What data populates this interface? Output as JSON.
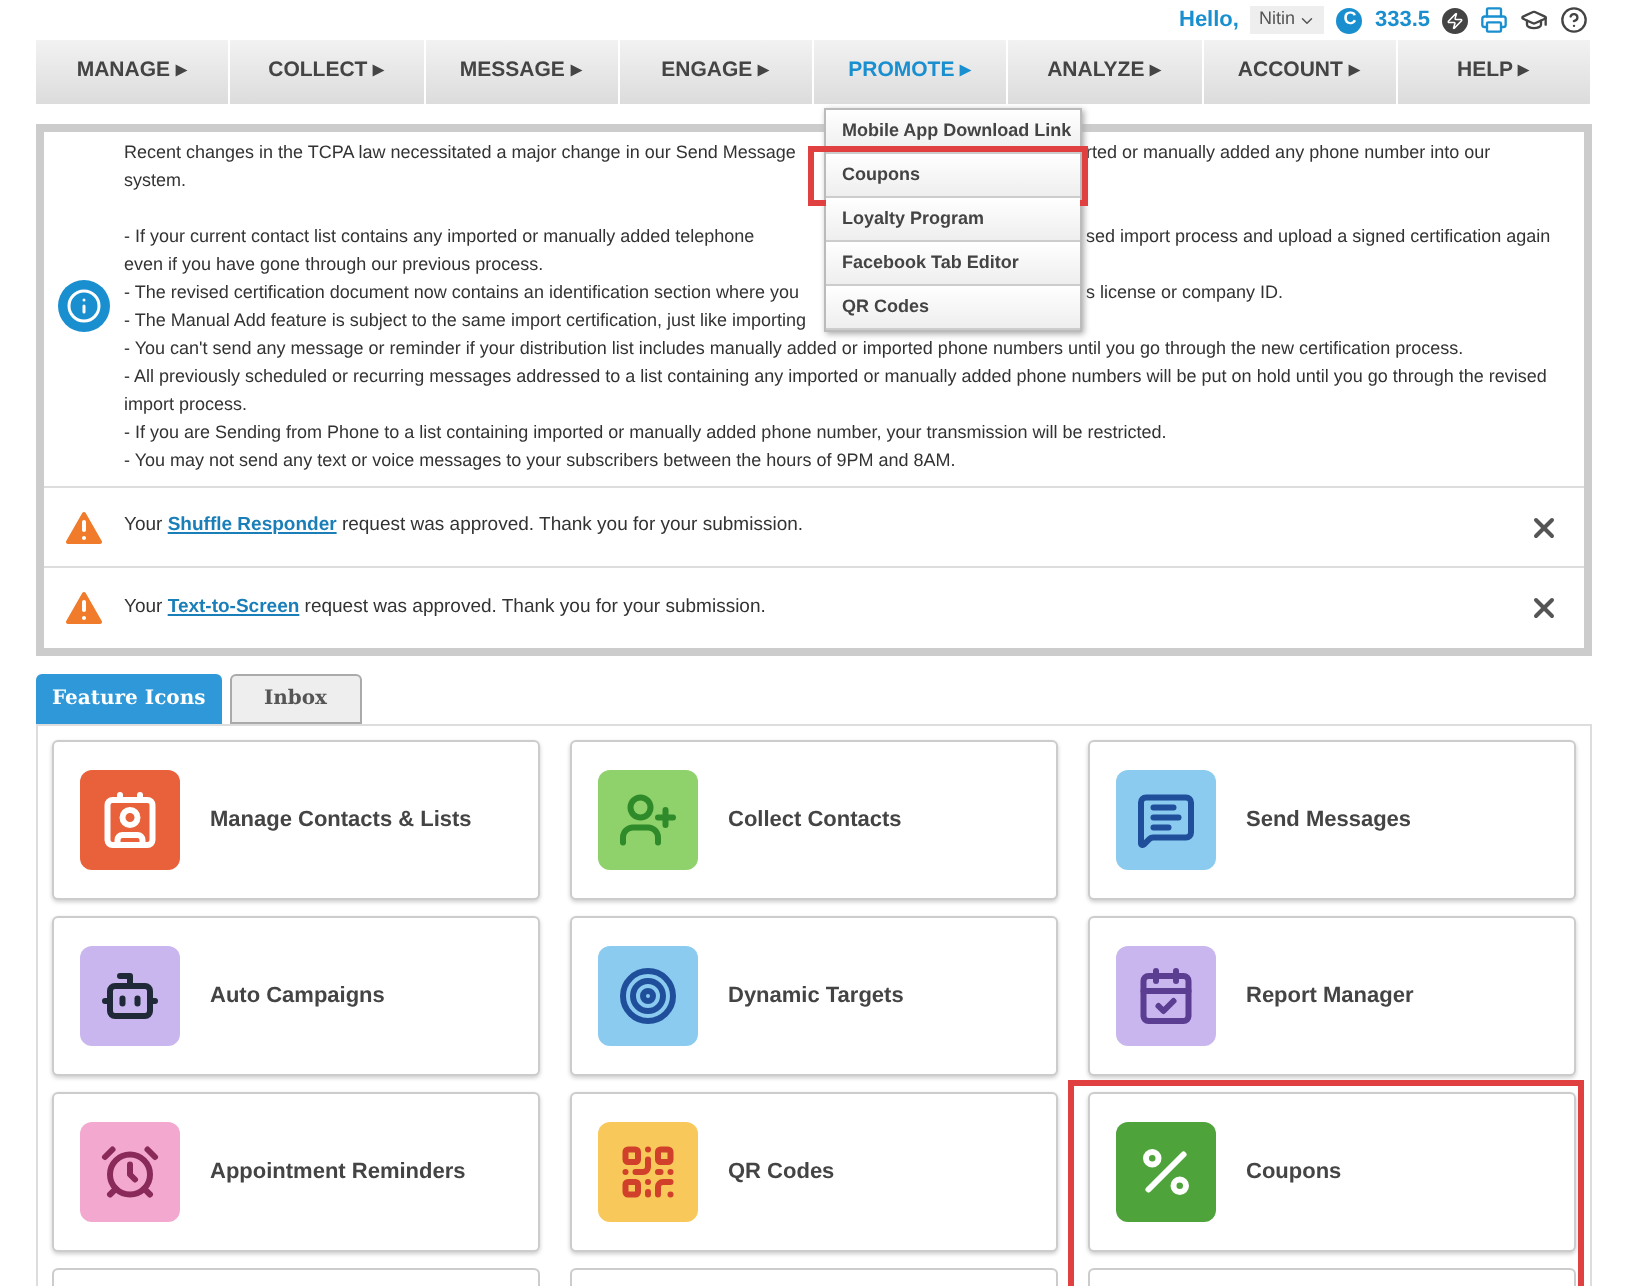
{
  "header": {
    "greeting": "Hello,",
    "user": "Nitin",
    "credits_badge": "C",
    "credits": "333.5"
  },
  "nav": [
    {
      "label": "MANAGE ▸",
      "selected": false
    },
    {
      "label": "COLLECT ▸",
      "selected": false
    },
    {
      "label": "MESSAGE ▸",
      "selected": false
    },
    {
      "label": "ENGAGE ▸",
      "selected": false
    },
    {
      "label": "PROMOTE ▸",
      "selected": true
    },
    {
      "label": "ANALYZE ▸",
      "selected": false
    },
    {
      "label": "ACCOUNT ▸",
      "selected": false
    },
    {
      "label": "HELP ▸",
      "selected": false
    }
  ],
  "dropdown": [
    {
      "label": "Mobile App Download Link",
      "highlighted": false
    },
    {
      "label": "Coupons",
      "highlighted": true
    },
    {
      "label": "Loyalty Program",
      "highlighted": false
    },
    {
      "label": "Facebook Tab Editor",
      "highlighted": false
    },
    {
      "label": "QR Codes",
      "highlighted": false
    }
  ],
  "notice_lines": [
    {
      "kind": "text",
      "left": "Recent changes in the TCPA law necessitated a major change in our Send Message",
      "right": "rted or manually added any phone number into our"
    },
    {
      "kind": "text",
      "left": "system."
    },
    {
      "kind": "blank"
    },
    {
      "kind": "text",
      "left": "- If your current contact list contains any imported or manually added telephone",
      "right": "sed import process and upload a signed certification again"
    },
    {
      "kind": "text",
      "left": "even if you have gone through our previous process."
    },
    {
      "kind": "text",
      "left": "- The revised certification document now contains an identification section where you",
      "right": "s license or company ID."
    },
    {
      "kind": "text",
      "left": "- The Manual Add feature is subject to the same import certification, just like importing"
    },
    {
      "kind": "text",
      "left": "- You can't send any message or reminder if your distribution list includes manually added or imported phone numbers until you go through the new certification process."
    },
    {
      "kind": "text",
      "left": "- All previously scheduled or recurring messages addressed to a list containing any imported or manually added phone numbers will be put on hold until you go through the revised"
    },
    {
      "kind": "text",
      "left": "import process."
    },
    {
      "kind": "text",
      "left": "- If you are Sending from Phone to a list containing imported or manually added phone number, your transmission will be restricted."
    },
    {
      "kind": "text",
      "left": "- You may not send any text or voice messages to your subscribers between the hours of 9PM and 8AM."
    }
  ],
  "alerts": [
    {
      "before": "Your",
      "link": "Shuffle Responder",
      "after": "request was approved. Thank you for your submission."
    },
    {
      "before": "Your",
      "link": "Text-to-Screen",
      "after": "request was approved. Thank you for your submission."
    }
  ],
  "tabs": [
    {
      "label": "Feature Icons",
      "selected": true
    },
    {
      "label": "Inbox",
      "selected": false
    }
  ],
  "features": [
    {
      "label": "Manage Contacts & Lists",
      "kind": "contacts",
      "color": "#e8613a",
      "highlighted": false
    },
    {
      "label": "Collect Contacts",
      "kind": "collect",
      "color": "#8fd16a",
      "highlighted": false
    },
    {
      "label": "Send Messages",
      "kind": "messages",
      "color": "#8ccbf0",
      "highlighted": false
    },
    {
      "label": "Auto Campaigns",
      "kind": "robot",
      "color": "#c9b6ef",
      "highlighted": false
    },
    {
      "label": "Dynamic Targets",
      "kind": "target",
      "color": "#8ccbf0",
      "highlighted": false
    },
    {
      "label": "Report Manager",
      "kind": "report",
      "color": "#c9b6ef",
      "highlighted": false
    },
    {
      "label": "Appointment Reminders",
      "kind": "alarm",
      "color": "#f3a9cf",
      "highlighted": false
    },
    {
      "label": "QR Codes",
      "kind": "qr",
      "color": "#f8c85a",
      "highlighted": false
    },
    {
      "label": "Coupons",
      "kind": "coupon",
      "color": "#4ea43a",
      "highlighted": true
    }
  ]
}
